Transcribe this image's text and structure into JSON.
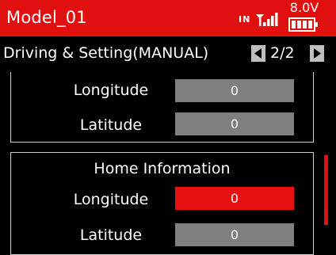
{
  "titlebar": {
    "model_name": "Model_01",
    "signal_label": "IN",
    "battery_voltage": "8.0V",
    "accent_color": "#e01010"
  },
  "header": {
    "title": "Driving & Setting(MANUAL)",
    "page_indicator": "2/2",
    "prev_icon": "triangle-left-icon",
    "next_icon": "triangle-right-icon"
  },
  "gps_section": {
    "rows": [
      {
        "label": "Longitude",
        "value": "0"
      },
      {
        "label": "Latitude",
        "value": "0"
      }
    ]
  },
  "home_section": {
    "title": "Home Information",
    "rows": [
      {
        "label": "Longitude",
        "value": "0",
        "selected": true
      },
      {
        "label": "Latitude",
        "value": "0",
        "selected": false
      }
    ]
  }
}
